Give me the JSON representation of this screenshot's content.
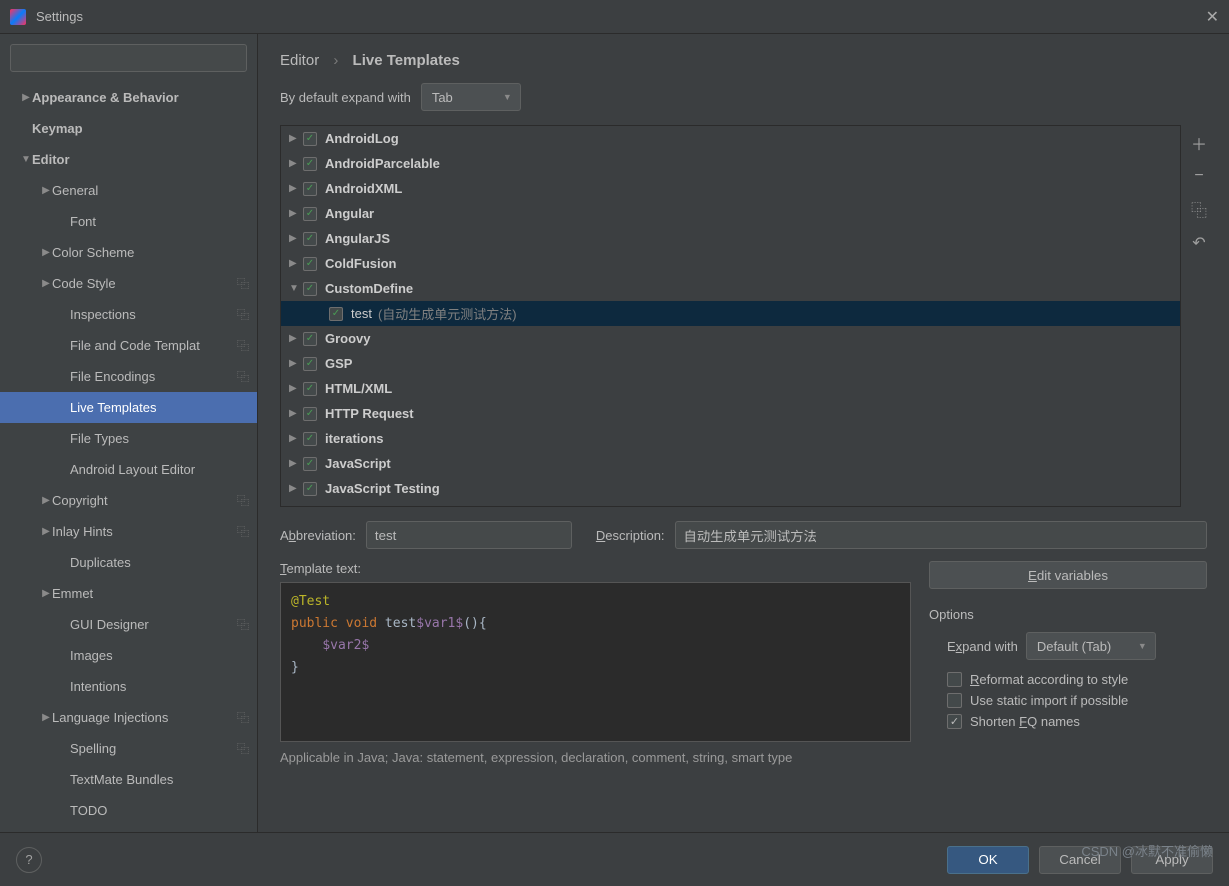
{
  "window": {
    "title": "Settings"
  },
  "breadcrumb": {
    "root": "Editor",
    "page": "Live Templates"
  },
  "expand": {
    "label": "By default expand with",
    "value": "Tab"
  },
  "sidebar": {
    "items": [
      {
        "label": "Appearance & Behavior",
        "level": 0,
        "arrow": "▶",
        "bold": true
      },
      {
        "label": "Keymap",
        "level": 0,
        "arrow": "",
        "bold": true
      },
      {
        "label": "Editor",
        "level": 0,
        "arrow": "▼",
        "bold": true
      },
      {
        "label": "General",
        "level": 1,
        "arrow": "▶"
      },
      {
        "label": "Font",
        "level": 2,
        "arrow": ""
      },
      {
        "label": "Color Scheme",
        "level": 1,
        "arrow": "▶"
      },
      {
        "label": "Code Style",
        "level": 1,
        "arrow": "▶",
        "copy": true
      },
      {
        "label": "Inspections",
        "level": 2,
        "arrow": "",
        "copy": true
      },
      {
        "label": "File and Code Templat",
        "level": 2,
        "arrow": "",
        "copy": true
      },
      {
        "label": "File Encodings",
        "level": 2,
        "arrow": "",
        "copy": true
      },
      {
        "label": "Live Templates",
        "level": 2,
        "arrow": "",
        "selected": true
      },
      {
        "label": "File Types",
        "level": 2,
        "arrow": ""
      },
      {
        "label": "Android Layout Editor",
        "level": 2,
        "arrow": ""
      },
      {
        "label": "Copyright",
        "level": 1,
        "arrow": "▶",
        "copy": true
      },
      {
        "label": "Inlay Hints",
        "level": 1,
        "arrow": "▶",
        "copy": true
      },
      {
        "label": "Duplicates",
        "level": 2,
        "arrow": ""
      },
      {
        "label": "Emmet",
        "level": 1,
        "arrow": "▶"
      },
      {
        "label": "GUI Designer",
        "level": 2,
        "arrow": "",
        "copy": true
      },
      {
        "label": "Images",
        "level": 2,
        "arrow": ""
      },
      {
        "label": "Intentions",
        "level": 2,
        "arrow": ""
      },
      {
        "label": "Language Injections",
        "level": 1,
        "arrow": "▶",
        "copy": true
      },
      {
        "label": "Spelling",
        "level": 2,
        "arrow": "",
        "copy": true
      },
      {
        "label": "TextMate Bundles",
        "level": 2,
        "arrow": ""
      },
      {
        "label": "TODO",
        "level": 2,
        "arrow": ""
      }
    ]
  },
  "templates": [
    {
      "name": "AndroidLog",
      "arrow": "▶",
      "checked": true
    },
    {
      "name": "AndroidParcelable",
      "arrow": "▶",
      "checked": true
    },
    {
      "name": "AndroidXML",
      "arrow": "▶",
      "checked": true
    },
    {
      "name": "Angular",
      "arrow": "▶",
      "checked": true
    },
    {
      "name": "AngularJS",
      "arrow": "▶",
      "checked": true
    },
    {
      "name": "ColdFusion",
      "arrow": "▶",
      "checked": true
    },
    {
      "name": "CustomDefine",
      "arrow": "▼",
      "checked": true,
      "expanded": true,
      "children": [
        {
          "name": "test",
          "desc": "(自动生成单元测试方法)",
          "checked": true,
          "hl": true
        }
      ]
    },
    {
      "name": "Groovy",
      "arrow": "▶",
      "checked": true
    },
    {
      "name": "GSP",
      "arrow": "▶",
      "checked": true
    },
    {
      "name": "HTML/XML",
      "arrow": "▶",
      "checked": true
    },
    {
      "name": "HTTP Request",
      "arrow": "▶",
      "checked": true
    },
    {
      "name": "iterations",
      "arrow": "▶",
      "checked": true
    },
    {
      "name": "JavaScript",
      "arrow": "▶",
      "checked": true
    },
    {
      "name": "JavaScript Testing",
      "arrow": "▶",
      "checked": true
    }
  ],
  "toolbar_icons": {
    "add": "＋",
    "remove": "−",
    "copy": "⿻",
    "undo": "↶"
  },
  "form": {
    "abbrev_label": "Abbreviation:",
    "abbrev_value": "test",
    "desc_label": "Description:",
    "desc_value": "自动生成单元测试方法",
    "template_label": "Template text:",
    "edit_vars": "Edit variables",
    "options_title": "Options",
    "expand_with_label": "Expand with",
    "expand_with_value": "Default (Tab)",
    "reformat": "Reformat according to style",
    "static_import": "Use static import if possible",
    "shorten_fq": "Shorten FQ names",
    "shorten_fq_checked": true
  },
  "code": {
    "l1_ann": "@Test",
    "l2_kw1": "public",
    "l2_kw2": "void",
    "l2_text": " test",
    "l2_var": "$var1$",
    "l2_end": "(){",
    "l3_var": "$var2$",
    "l4": "}"
  },
  "applicable": "Applicable in Java; Java: statement, expression, declaration, comment, string, smart type",
  "footer": {
    "ok": "OK",
    "cancel": "Cancel",
    "apply": "Apply",
    "help": "?"
  },
  "watermark": "CSDN @冰默不准偷懒"
}
